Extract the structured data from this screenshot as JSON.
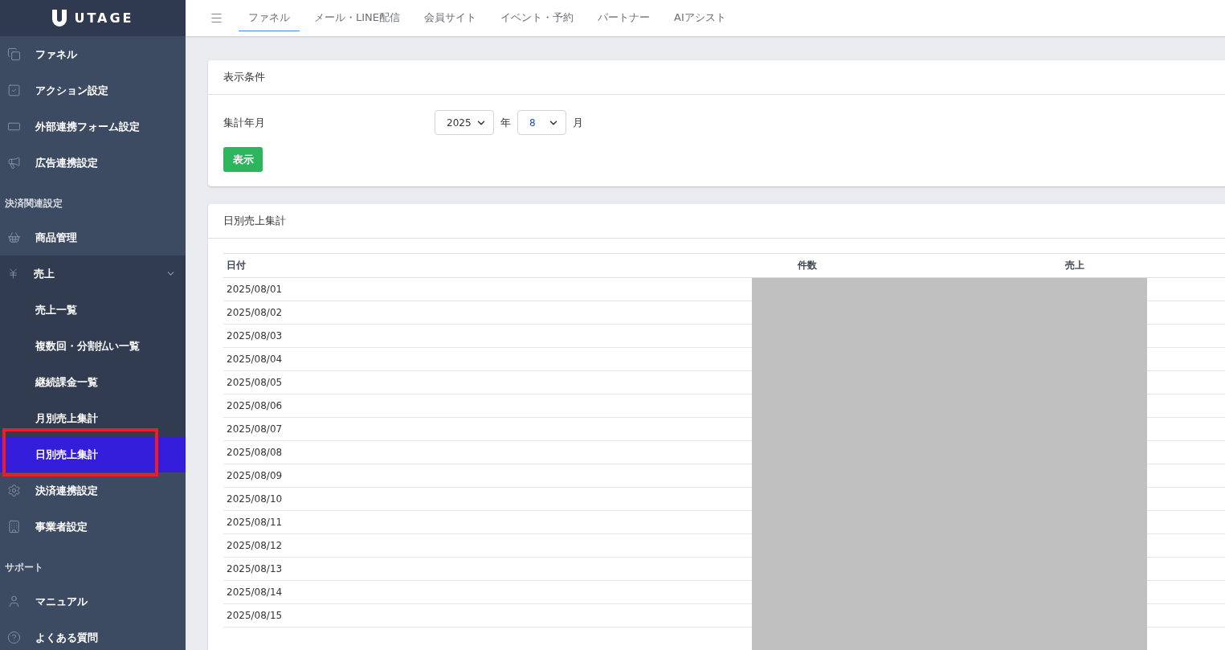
{
  "logo": {
    "text": "UTAGE"
  },
  "sidebar": {
    "items": [
      {
        "kind": "item",
        "label": "ファネル"
      },
      {
        "kind": "item",
        "label": "アクション設定"
      },
      {
        "kind": "item",
        "label": "外部連携フォーム設定"
      },
      {
        "kind": "item",
        "label": "広告連携設定"
      },
      {
        "kind": "section",
        "label": "決済関連設定"
      },
      {
        "kind": "item",
        "label": "商品管理"
      },
      {
        "kind": "group",
        "label": "売上",
        "expanded": true,
        "children": [
          {
            "label": "売上一覧",
            "selected": false,
            "highlighted": false
          },
          {
            "label": "複数回・分割払い一覧",
            "selected": false,
            "highlighted": false
          },
          {
            "label": "継続課金一覧",
            "selected": false,
            "highlighted": false
          },
          {
            "label": "月別売上集計",
            "selected": false,
            "highlighted": false
          },
          {
            "label": "日別売上集計",
            "selected": true,
            "highlighted": true
          }
        ]
      },
      {
        "kind": "item",
        "label": "決済連携設定"
      },
      {
        "kind": "item",
        "label": "事業者設定"
      },
      {
        "kind": "section",
        "label": "サポート"
      },
      {
        "kind": "item",
        "label": "マニュアル"
      },
      {
        "kind": "item",
        "label": "よくある質問"
      }
    ]
  },
  "tabs": [
    {
      "label": "ファネル",
      "selected": true
    },
    {
      "label": "メール・LINE配信",
      "selected": false
    },
    {
      "label": "会員サイト",
      "selected": false
    },
    {
      "label": "イベント・予約",
      "selected": false
    },
    {
      "label": "パートナー",
      "selected": false
    },
    {
      "label": "AIアシスト",
      "selected": false
    }
  ],
  "filter": {
    "title": "表示条件",
    "label": "集計年月",
    "year": "2025",
    "year_unit": "年",
    "month": "8",
    "month_unit": "月",
    "button": "表示"
  },
  "table": {
    "title": "日別売上集計",
    "redacted": true,
    "columns": [
      "日付",
      "件数",
      "売上"
    ],
    "rows": [
      "2025/08/01",
      "2025/08/02",
      "2025/08/03",
      "2025/08/04",
      "2025/08/05",
      "2025/08/06",
      "2025/08/07",
      "2025/08/08",
      "2025/08/09",
      "2025/08/10",
      "2025/08/11",
      "2025/08/12",
      "2025/08/13",
      "2025/08/14",
      "2025/08/15"
    ]
  }
}
